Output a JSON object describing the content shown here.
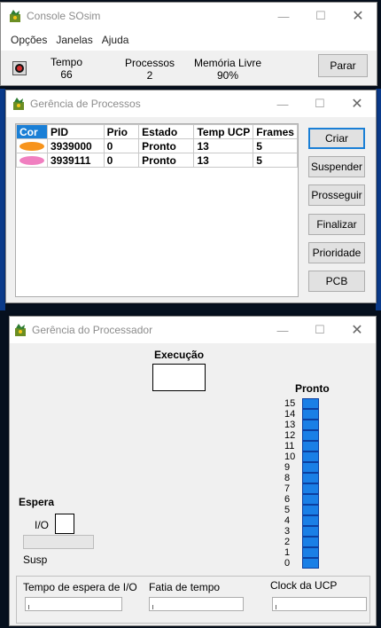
{
  "console": {
    "title": "Console SOsim",
    "menu": [
      "Opções",
      "Janelas",
      "Ajuda"
    ],
    "stats": [
      {
        "label": "Tempo",
        "value": "66"
      },
      {
        "label": "Processos",
        "value": "2"
      },
      {
        "label": "Memória Livre",
        "value": "90%"
      }
    ],
    "stop_label": "Parar"
  },
  "processes": {
    "title": "Gerência de Processos",
    "columns": [
      "Cor",
      "PID",
      "Prio",
      "Estado",
      "Temp UCP",
      "Frames"
    ],
    "rows": [
      {
        "color": "#f7941d",
        "pid": "3939000",
        "prio": "0",
        "state": "Pronto",
        "cpu": "13",
        "frames": "5"
      },
      {
        "color": "#f07fc0",
        "pid": "3939111",
        "prio": "0",
        "state": "Pronto",
        "cpu": "13",
        "frames": "5"
      }
    ],
    "buttons": [
      "Criar",
      "Suspender",
      "Prosseguir",
      "Finalizar",
      "Prioridade",
      "PCB"
    ]
  },
  "processor": {
    "title": "Gerência do Processador",
    "execution_label": "Execução",
    "ready_label": "Pronto",
    "ready_levels": [
      "15",
      "14",
      "13",
      "12",
      "11",
      "10",
      "9",
      "8",
      "7",
      "6",
      "5",
      "4",
      "3",
      "2",
      "1",
      "0"
    ],
    "wait_label": "Espera",
    "io_label": "I/O",
    "susp_label": "Susp",
    "sliders": [
      "Tempo de espera de I/O",
      "Fatia de tempo",
      "Clock da UCP"
    ]
  },
  "colors": {
    "accent": "#1a7fd6",
    "queue": "#1a7fe6"
  }
}
